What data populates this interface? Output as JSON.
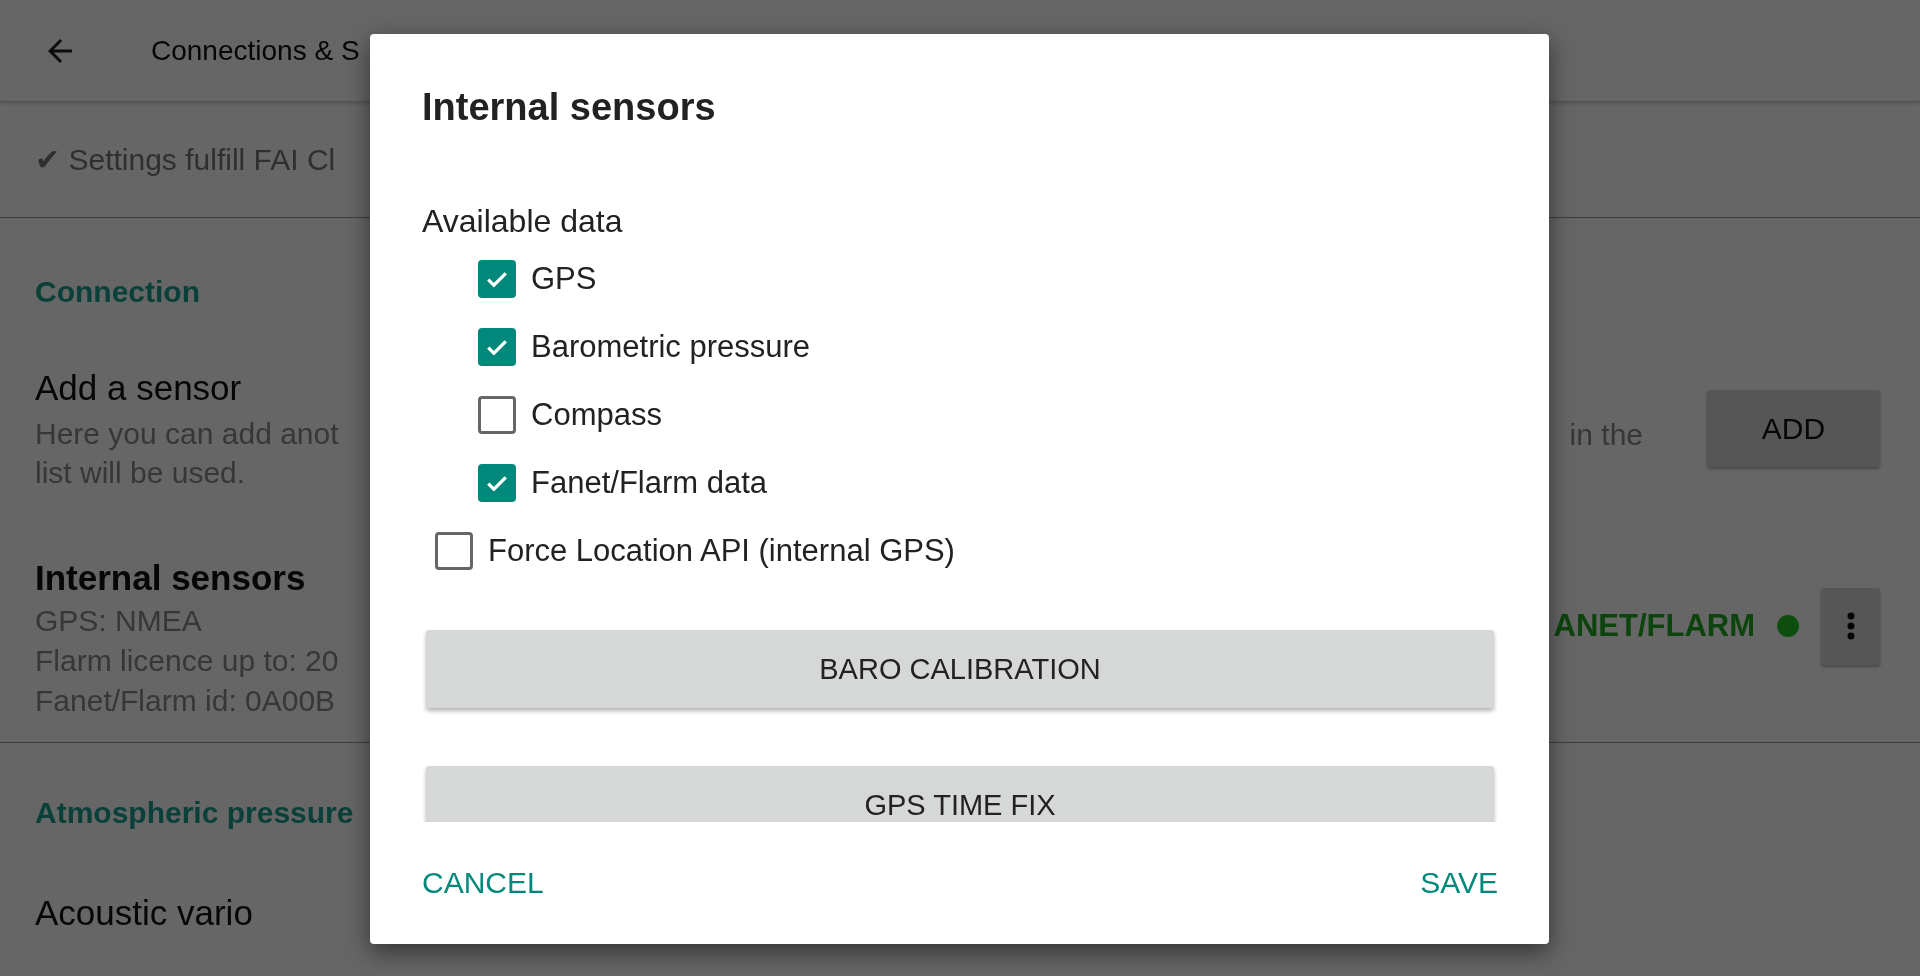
{
  "app_bar": {
    "title": "Connections & S"
  },
  "compliance": {
    "text": "✔ Settings fulfill FAI Cl"
  },
  "connection_header": "Connection",
  "add_sensor": {
    "title": "Add a sensor",
    "description": "Here you can add anot\nlist will be used.",
    "description_fragment": "in the",
    "button": "ADD"
  },
  "sensor": {
    "title": "Internal sensors",
    "details": [
      "GPS: NMEA",
      "Flarm licence up to: 20",
      "Fanet/Flarm id: 0A00B"
    ],
    "status": "ANET/FLARM",
    "color": "#0d4d0d"
  },
  "atmospheric_header": "Atmospheric pressure",
  "acoustic_vario": {
    "title": "Acoustic vario"
  },
  "dialog": {
    "title": "Internal sensors",
    "available_data": {
      "label": "Available data",
      "items": [
        {
          "label": "GPS",
          "checked": true
        },
        {
          "label": "Barometric pressure",
          "checked": true
        },
        {
          "label": "Compass",
          "checked": false
        },
        {
          "label": "Fanet/Flarm data",
          "checked": true
        }
      ]
    },
    "force_location_api": {
      "label": "Force Location API (internal GPS)",
      "checked": false
    },
    "buttons": [
      "BARO CALIBRATION",
      "GPS TIME FIX"
    ],
    "actions": [
      "CANCEL",
      "SAVE"
    ]
  }
}
